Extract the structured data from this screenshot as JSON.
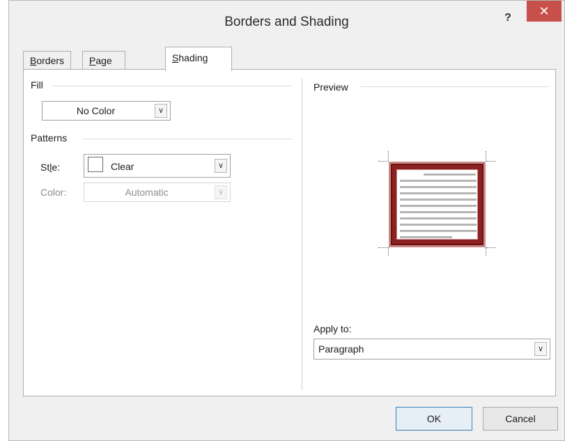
{
  "dialog": {
    "title": "Borders and Shading",
    "help": "?",
    "close": "✕"
  },
  "tabs": [
    {
      "label": "Borders",
      "u": "B",
      "rest": "orders"
    },
    {
      "label": "Page Border",
      "u": "P",
      "rest": "age Border"
    },
    {
      "label": "Shading",
      "u": "S",
      "rest": "hading",
      "active": true
    }
  ],
  "fill": {
    "section_label": "Fill",
    "value": "No Color"
  },
  "patterns": {
    "section_label": "Patterns",
    "style_label": "Style:",
    "style_u": "l",
    "style_value": "Clear",
    "color_label": "Color:",
    "color_value": "Automatic"
  },
  "preview": {
    "section_label": "Preview",
    "border_color": "#8b2221"
  },
  "apply_to": {
    "label": "Apply to:",
    "value": "Paragraph"
  },
  "buttons": {
    "ok": "OK",
    "cancel": "Cancel"
  },
  "icons": {
    "dropdown": "chevron-down-icon",
    "close": "close-icon",
    "help": "help-icon"
  }
}
